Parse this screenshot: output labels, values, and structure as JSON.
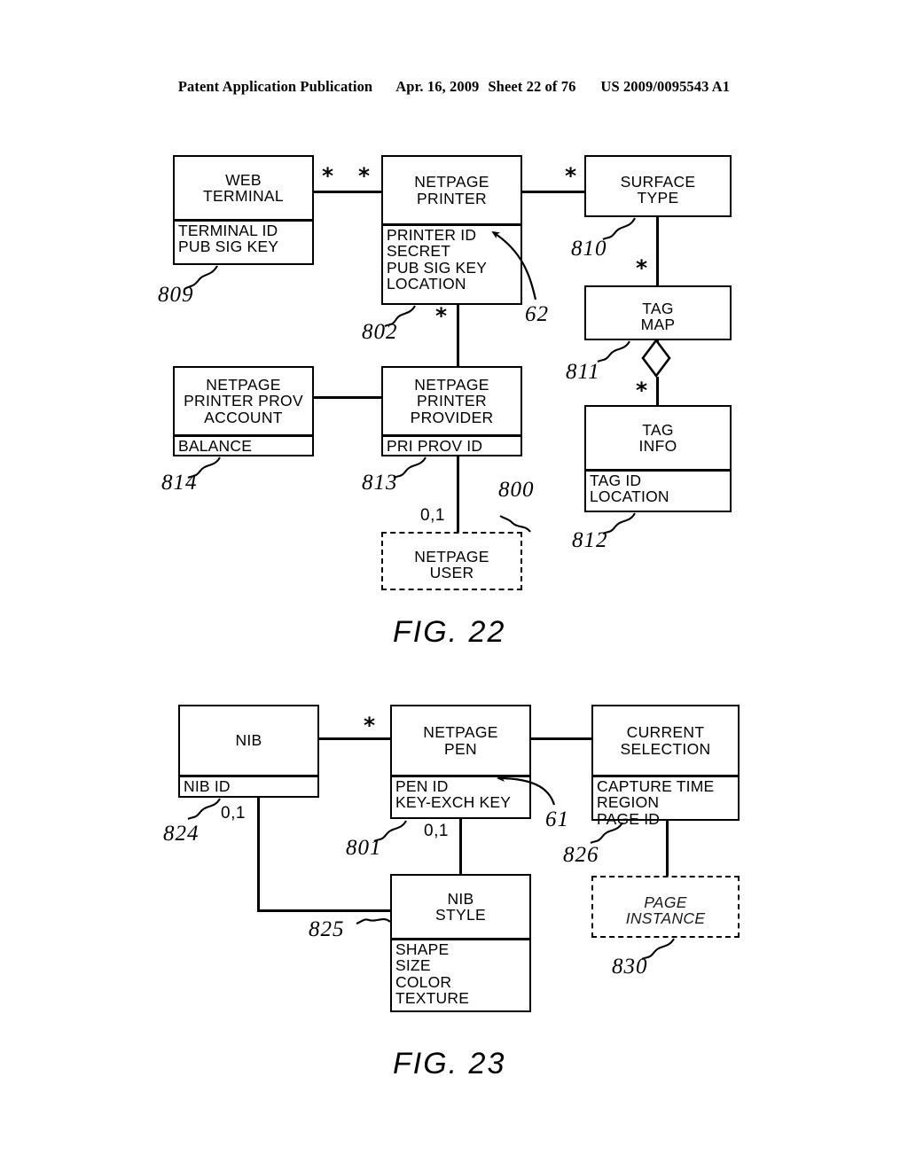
{
  "header": {
    "publication": "Patent Application Publication",
    "date": "Apr. 16, 2009",
    "sheet": "Sheet 22 of 76",
    "patent_number": "US 2009/0095543 A1"
  },
  "figures": [
    {
      "caption": "FIG. 22",
      "entities": [
        {
          "id": "web-terminal",
          "title": [
            "WEB",
            "TERMINAL"
          ],
          "attributes": [
            "TERMINAL ID",
            "PUB SIG KEY"
          ],
          "ref": "809",
          "style": "solid"
        },
        {
          "id": "netpage-printer",
          "title": [
            "NETPAGE",
            "PRINTER"
          ],
          "attributes": [
            "PRINTER ID",
            "SECRET",
            "PUB SIG KEY",
            "LOCATION"
          ],
          "ref": "802",
          "style": "solid"
        },
        {
          "id": "surface-type",
          "title": [
            "SURFACE",
            "TYPE"
          ],
          "attributes": [],
          "ref": "810",
          "style": "solid"
        },
        {
          "id": "tag-map",
          "title": [
            "TAG",
            "MAP"
          ],
          "attributes": [],
          "ref": "811",
          "style": "solid"
        },
        {
          "id": "tag-info",
          "title": [
            "TAG",
            "INFO"
          ],
          "attributes": [
            "TAG ID",
            "LOCATION"
          ],
          "ref": "812",
          "style": "solid"
        },
        {
          "id": "netpage-printer-prov-account",
          "title": [
            "NETPAGE",
            "PRINTER PROV",
            "ACCOUNT"
          ],
          "attributes": [
            "BALANCE"
          ],
          "ref": "814",
          "style": "solid"
        },
        {
          "id": "netpage-printer-provider",
          "title": [
            "NETPAGE",
            "PRINTER",
            "PROVIDER"
          ],
          "attributes": [
            "PRI PROV ID"
          ],
          "ref": "813",
          "style": "solid"
        },
        {
          "id": "netpage-user",
          "title": [
            "NETPAGE",
            "USER"
          ],
          "attributes": [],
          "ref": "800",
          "style": "dashed"
        }
      ],
      "multiplicities": [
        "*",
        "*",
        "*",
        "*",
        "*",
        "*",
        "0,1"
      ],
      "callouts": [
        "62"
      ]
    },
    {
      "caption": "FIG. 23",
      "entities": [
        {
          "id": "nib",
          "title": [
            "NIB"
          ],
          "attributes": [
            "NIB ID"
          ],
          "ref": "824",
          "style": "solid"
        },
        {
          "id": "netpage-pen",
          "title": [
            "NETPAGE",
            "PEN"
          ],
          "attributes": [
            "PEN ID",
            "KEY-EXCH KEY"
          ],
          "ref": "801",
          "style": "solid"
        },
        {
          "id": "current-selection",
          "title": [
            "CURRENT",
            "SELECTION"
          ],
          "attributes": [
            "CAPTURE TIME",
            "REGION",
            "PAGE ID"
          ],
          "ref": "826",
          "style": "solid"
        },
        {
          "id": "nib-style",
          "title": [
            "NIB",
            "STYLE"
          ],
          "attributes": [
            "SHAPE",
            "SIZE",
            "COLOR",
            "TEXTURE"
          ],
          "ref": "825",
          "style": "solid"
        },
        {
          "id": "page-instance",
          "title": [
            "PAGE",
            "INSTANCE"
          ],
          "attributes": [],
          "ref": "830",
          "style": "dashed-italic"
        }
      ],
      "multiplicities": [
        "*",
        "0,1",
        "0,1"
      ],
      "callouts": [
        "61"
      ]
    }
  ],
  "f22": {
    "web_terminal": {
      "t1": "WEB",
      "t2": "TERMINAL",
      "a1": "TERMINAL ID",
      "a2": "PUB SIG KEY",
      "ref": "809"
    },
    "netpage_printer": {
      "t1": "NETPAGE",
      "t2": "PRINTER",
      "a1": "PRINTER ID",
      "a2": "SECRET",
      "a3": "PUB SIG KEY",
      "a4": "LOCATION",
      "ref": "802"
    },
    "surface_type": {
      "t1": "SURFACE",
      "t2": "TYPE",
      "ref": "810"
    },
    "tag_map": {
      "t1": "TAG",
      "t2": "MAP",
      "ref": "811"
    },
    "tag_info": {
      "t1": "TAG",
      "t2": "INFO",
      "a1": "TAG ID",
      "a2": "LOCATION",
      "ref": "812"
    },
    "prov_account": {
      "t1": "NETPAGE",
      "t2": "PRINTER PROV",
      "t3": "ACCOUNT",
      "a1": "BALANCE",
      "ref": "814"
    },
    "printer_provider": {
      "t1": "NETPAGE",
      "t2": "PRINTER",
      "t3": "PROVIDER",
      "a1": "PRI PROV ID",
      "ref": "813"
    },
    "netpage_user": {
      "t1": "NETPAGE",
      "t2": "USER",
      "ref": "800"
    },
    "ast_wt": "*",
    "ast_np": "*",
    "ast_st": "*",
    "ast_tm": "*",
    "ast_ti": "*",
    "ast_pp": "*",
    "mult_user": "0,1",
    "callout_62": "62",
    "caption": "FIG. 22"
  },
  "f23": {
    "nib": {
      "t1": "NIB",
      "a1": "NIB ID",
      "ref": "824"
    },
    "netpage_pen": {
      "t1": "NETPAGE",
      "t2": "PEN",
      "a1": "PEN ID",
      "a2": "KEY-EXCH KEY",
      "ref": "801"
    },
    "current_selection": {
      "t1": "CURRENT",
      "t2": "SELECTION",
      "a1": "CAPTURE TIME",
      "a2": "REGION",
      "a3": "PAGE ID",
      "ref": "826"
    },
    "nib_style": {
      "t1": "NIB",
      "t2": "STYLE",
      "a1": "SHAPE",
      "a2": "SIZE",
      "a3": "COLOR",
      "a4": "TEXTURE",
      "ref": "825"
    },
    "page_instance": {
      "t1": "PAGE",
      "t2": "INSTANCE",
      "ref": "830"
    },
    "ast_pen": "*",
    "mult_nib": "0,1",
    "mult_pen": "0,1",
    "callout_61": "61",
    "caption": "FIG. 23"
  }
}
